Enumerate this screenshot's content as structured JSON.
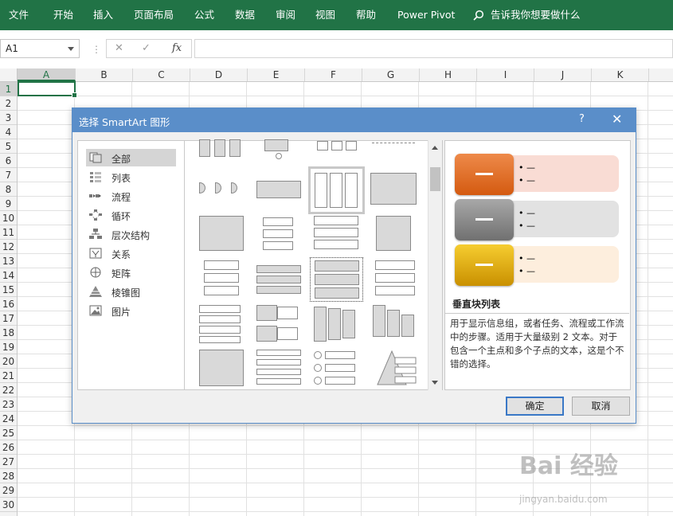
{
  "ribbon": {
    "tabs": [
      "文件",
      "开始",
      "插入",
      "页面布局",
      "公式",
      "数据",
      "审阅",
      "视图",
      "帮助",
      "Power Pivot"
    ],
    "search_placeholder": "告诉我你想要做什么",
    "color": "#217346"
  },
  "formula_bar": {
    "name_box": "A1",
    "fx_label": "fx",
    "cancel_icon": "x-icon",
    "enter_icon": "check-icon",
    "value": ""
  },
  "sheet": {
    "columns": [
      "A",
      "B",
      "C",
      "D",
      "E",
      "F",
      "G",
      "H",
      "I",
      "J",
      "K"
    ],
    "rows": [
      "1",
      "2",
      "3",
      "4",
      "5",
      "6",
      "7",
      "8",
      "9",
      "10",
      "11",
      "12",
      "13",
      "14",
      "15",
      "16",
      "17",
      "18",
      "19",
      "20",
      "21",
      "22",
      "23",
      "24",
      "25",
      "26",
      "27",
      "28",
      "29",
      "30"
    ],
    "selected_cell": "A1"
  },
  "dialog": {
    "title": "选择 SmartArt 图形",
    "help_label": "?",
    "close_label": "✕",
    "categories": [
      {
        "label": "全部",
        "icon": "all-icon"
      },
      {
        "label": "列表",
        "icon": "list-icon"
      },
      {
        "label": "流程",
        "icon": "process-icon"
      },
      {
        "label": "循环",
        "icon": "cycle-icon"
      },
      {
        "label": "层次结构",
        "icon": "hierarchy-icon"
      },
      {
        "label": "关系",
        "icon": "relationship-icon"
      },
      {
        "label": "矩阵",
        "icon": "matrix-icon"
      },
      {
        "label": "棱锥图",
        "icon": "pyramid-icon"
      },
      {
        "label": "图片",
        "icon": "picture-icon"
      }
    ],
    "selected_category": "全部",
    "preview": {
      "name": "垂直块列表",
      "description": "用于显示信息组，或者任务、流程或工作流中的步骤。适用于大量级别 2 文本。对于包含一个主点和多个子点的文本，这是个不错的选择。",
      "item_dash": "—",
      "bullet": "• —",
      "colors": [
        {
          "box": "#e46c1e",
          "bar": "#f9dcd4"
        },
        {
          "box": "#8c8c8c",
          "bar": "#e2e2e2"
        },
        {
          "box": "#e3b010",
          "bar": "#fdeedd"
        }
      ]
    },
    "ok_label": "确定",
    "cancel_label": "取消"
  },
  "watermark": {
    "main": "Bai 经验",
    "sub": "jingyan.baidu.com"
  }
}
